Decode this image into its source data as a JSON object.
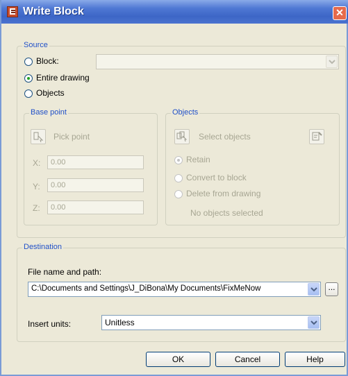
{
  "window": {
    "title": "Write Block",
    "close_glyph": "✕"
  },
  "source": {
    "title": "Source",
    "block_label": "Block:",
    "entire_drawing_label": "Entire drawing",
    "objects_label": "Objects",
    "selected": "Entire drawing"
  },
  "base_point": {
    "title": "Base point",
    "pick_point_label": "Pick point",
    "x_label": "X:",
    "y_label": "Y:",
    "z_label": "Z:",
    "x": "0.00",
    "y": "0.00",
    "z": "0.00"
  },
  "objects": {
    "title": "Objects",
    "select_objects_label": "Select objects",
    "retain_label": "Retain",
    "convert_label": "Convert to block",
    "delete_label": "Delete from drawing",
    "status": "No objects selected"
  },
  "destination": {
    "title": "Destination",
    "file_label": "File name and path:",
    "file_path": "C:\\Documents and Settings\\J_DiBona\\My Documents\\FixMeNow",
    "ellipsis": "...",
    "units_label": "Insert units:",
    "units_value": "Unitless"
  },
  "buttons": {
    "ok": "OK",
    "cancel": "Cancel",
    "help": "Help"
  },
  "colors": {
    "title_bar": "#3d66c6",
    "group_title": "#2050c8",
    "dialog_bg": "#ece9d8"
  },
  "icons": {
    "app": "write-block-icon",
    "pick": "pick-point-icon",
    "select": "select-objects-icon",
    "quick": "quick-select-icon"
  }
}
